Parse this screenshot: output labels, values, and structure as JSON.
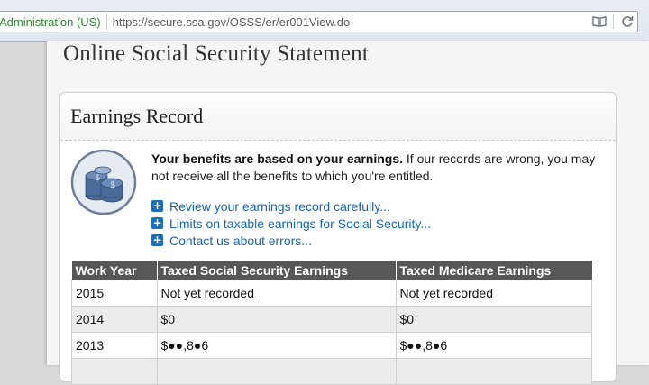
{
  "browser": {
    "site_identity": "Administration (US)",
    "url": "https://secure.ssa.gov/OSSS/er/er001View.do",
    "reader_icon": "reader-view-icon",
    "refresh_icon": "refresh-icon"
  },
  "page": {
    "title": "Online Social Security Statement"
  },
  "panel": {
    "title": "Earnings Record",
    "intro_bold": "Your benefits are based on your earnings.",
    "intro_rest": " If our records are wrong, you may not receive all the benefits to which you're entitled.",
    "icon": "coin-stacks-icon",
    "links": [
      {
        "label": "Review your earnings record carefully..."
      },
      {
        "label": "Limits on taxable earnings for Social Security..."
      },
      {
        "label": "Contact us about errors..."
      }
    ]
  },
  "table": {
    "headers": [
      "Work Year",
      "Taxed Social Security Earnings",
      "Taxed Medicare Earnings"
    ],
    "rows": [
      {
        "year": "2015",
        "ss": "Not yet recorded",
        "medicare": "Not yet recorded"
      },
      {
        "year": "2014",
        "ss": "$0",
        "medicare": "$0"
      },
      {
        "year": "2013",
        "ss": "$●●,8●6",
        "medicare": "$●●,8●6"
      }
    ]
  },
  "colors": {
    "link": "#1565b7",
    "header_bg": "#575757",
    "site_identity": "#2f8a33"
  }
}
